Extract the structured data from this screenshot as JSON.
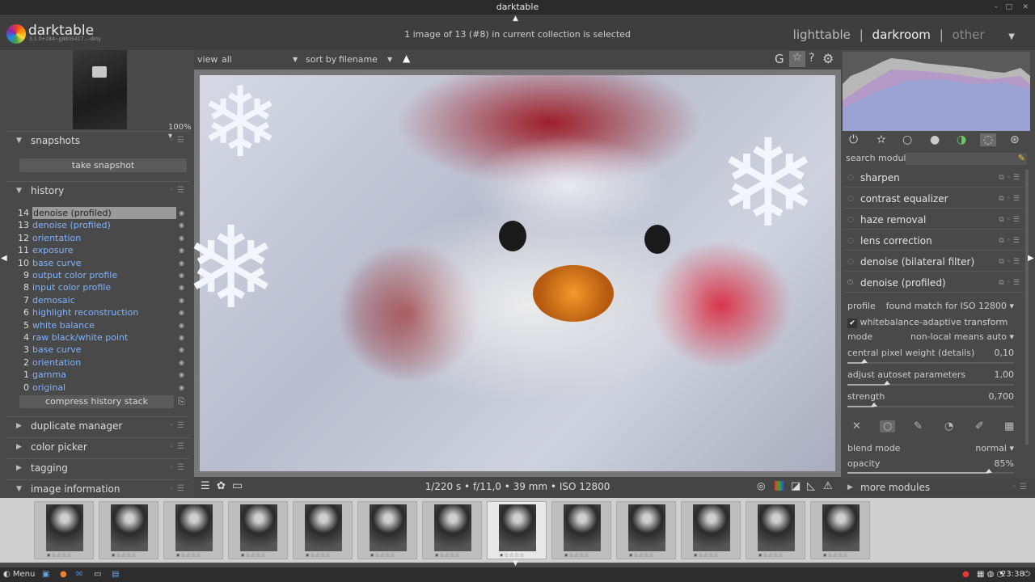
{
  "window": {
    "title": "darktable"
  },
  "header": {
    "app_name": "darktable",
    "version": "3.1.0+284~g8805417...-dirty",
    "selection_info": "1 image of 13 (#8) in current collection is selected",
    "views": {
      "lighttable": "lighttable",
      "separator": "|",
      "darkroom": "darkroom",
      "other": "other"
    }
  },
  "left": {
    "zoom": "100%",
    "snapshots": {
      "label": "snapshots",
      "take_snapshot": "take snapshot"
    },
    "history": {
      "label": "history",
      "items": [
        {
          "n": "14",
          "label": "denoise (profiled)"
        },
        {
          "n": "13",
          "label": "denoise (profiled)"
        },
        {
          "n": "12",
          "label": "orientation"
        },
        {
          "n": "11",
          "label": "exposure"
        },
        {
          "n": "10",
          "label": "base curve"
        },
        {
          "n": "9",
          "label": "output color profile"
        },
        {
          "n": "8",
          "label": "input color profile"
        },
        {
          "n": "7",
          "label": "demosaic"
        },
        {
          "n": "6",
          "label": "highlight reconstruction"
        },
        {
          "n": "5",
          "label": "white balance"
        },
        {
          "n": "4",
          "label": "raw black/white point"
        },
        {
          "n": "3",
          "label": "base curve"
        },
        {
          "n": "2",
          "label": "orientation"
        },
        {
          "n": "1",
          "label": "gamma"
        },
        {
          "n": "0",
          "label": "original"
        }
      ],
      "compress": "compress history stack"
    },
    "duplicate": "duplicate manager",
    "color_picker": "color picker",
    "tagging": "tagging",
    "image_info": "image information"
  },
  "toolbar": {
    "view_label": "view",
    "view_value": "all",
    "sort_label": "sort by",
    "sort_value": "filename"
  },
  "exif": "1/220 s • f/11,0 • 39 mm • ISO 12800",
  "right": {
    "search_label": "search module",
    "modules": [
      "sharpen",
      "contrast equalizer",
      "haze removal",
      "lens correction",
      "denoise (bilateral filter)",
      "denoise (profiled)"
    ],
    "profile_label": "profile",
    "profile_value": "found match for ISO 12800",
    "wb_label": "whitebalance-adaptive transform",
    "mode_label": "mode",
    "mode_value": "non-local means auto",
    "cpw_label": "central pixel weight (details)",
    "cpw_value": "0,10",
    "cpw_level": 0.1,
    "autoset_label": "adjust autoset parameters",
    "autoset_value": "1,00",
    "autoset_level": 0.24,
    "strength_label": "strength",
    "strength_value": "0,700",
    "strength_level": 0.16,
    "blend_label": "blend mode",
    "blend_value": "normal",
    "opacity_label": "opacity",
    "opacity_value": "85%",
    "opacity_level": 0.85,
    "more": "more modules"
  },
  "taskbar": {
    "menu": "Menu",
    "clock": "23:38"
  }
}
